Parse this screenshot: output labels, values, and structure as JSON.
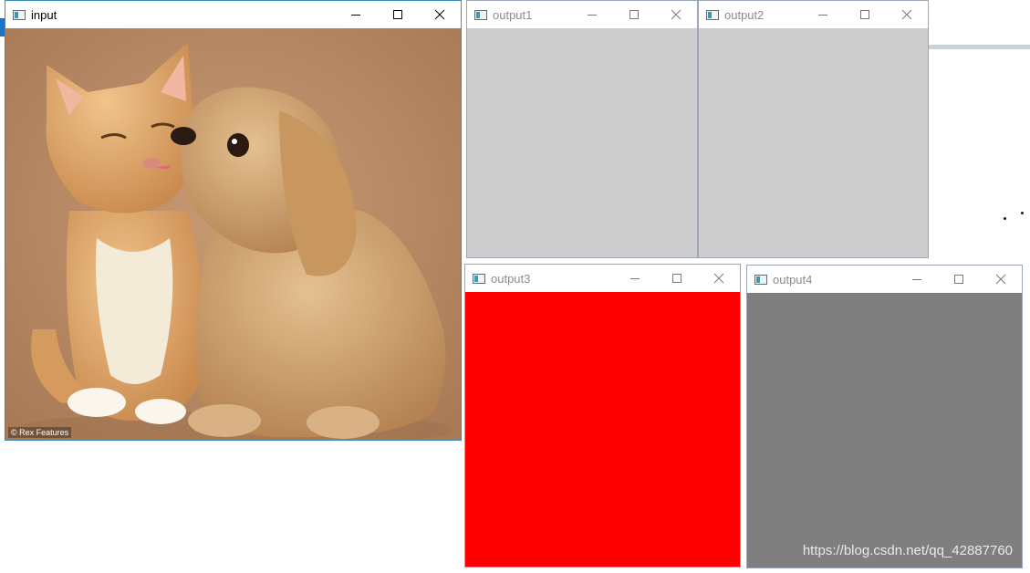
{
  "windows": [
    {
      "id": "input",
      "title": "input",
      "active": true,
      "content": "photo",
      "photo_credit": "© Rex Features"
    },
    {
      "id": "output1",
      "title": "output1",
      "active": false,
      "fill": "#cdcdcd"
    },
    {
      "id": "output2",
      "title": "output2",
      "active": false,
      "fill": "#cdcdcd"
    },
    {
      "id": "output3",
      "title": "output3",
      "active": false,
      "fill": "#ff0000"
    },
    {
      "id": "output4",
      "title": "output4",
      "active": false,
      "fill": "#7f7f7f"
    }
  ],
  "controls": {
    "minimize": "minimize-icon",
    "maximize": "maximize-icon",
    "close": "close-icon"
  },
  "watermark": "https://blog.csdn.net/qq_42887760"
}
